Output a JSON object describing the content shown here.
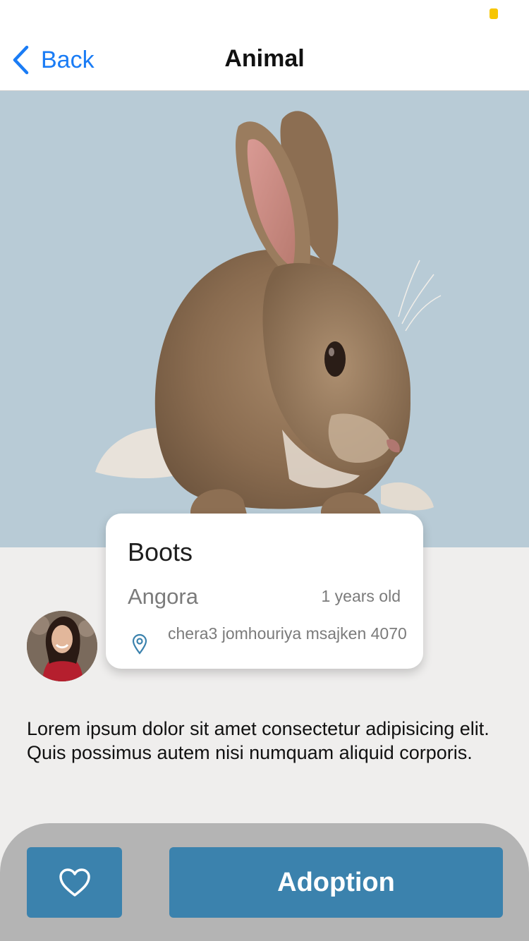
{
  "nav": {
    "back_label": "Back",
    "title": "Animal"
  },
  "pet": {
    "name": "Boots",
    "breed": "Angora",
    "age": "1 years old",
    "address": "chera3 jomhouriya msajken 4070"
  },
  "description": "Lorem ipsum dolor sit amet consectetur adipisicing elit. Quis possimus autem nisi numquam aliquid corporis.",
  "actions": {
    "adopt_label": "Adoption"
  },
  "colors": {
    "accent": "#3b82ad",
    "link": "#1a7cf5",
    "hero_background": "#b8cbd6",
    "page_background": "#efeeed",
    "bottom_bar": "#b4b4b4"
  },
  "icons": {
    "back": "chevron-left-icon",
    "location": "map-pin-icon",
    "favorite": "heart-outline-icon"
  }
}
